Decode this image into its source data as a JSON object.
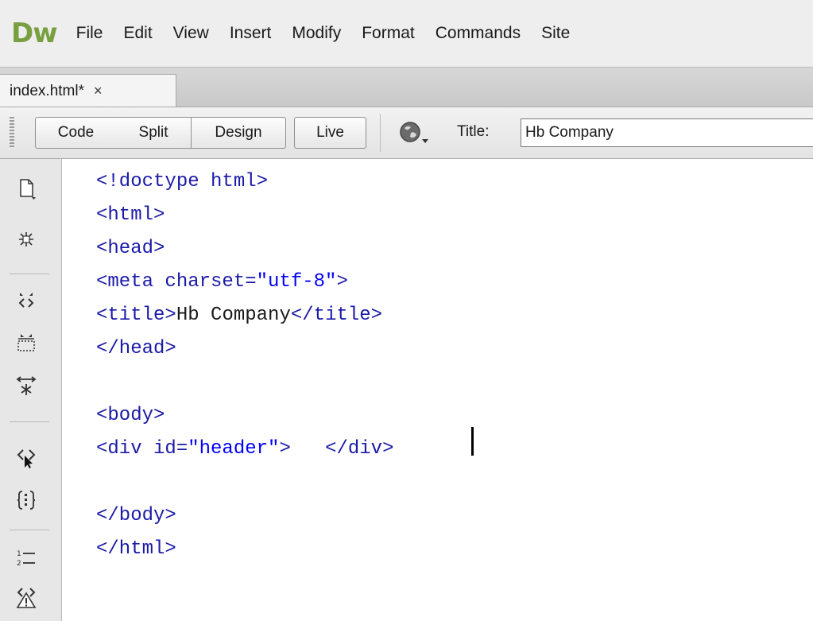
{
  "app": {
    "logo": "Dw",
    "menu": [
      "File",
      "Edit",
      "View",
      "Insert",
      "Modify",
      "Format",
      "Commands",
      "Site"
    ]
  },
  "document_tab": {
    "label": "index.html*",
    "close_glyph": "×"
  },
  "doc_toolbar": {
    "code_label": "Code",
    "split_label": "Split",
    "design_label": "Design",
    "live_label": "Live",
    "title_label": "Title:",
    "title_value": "Hb Company",
    "globe_icon": "globe-preview-icon"
  },
  "coding_toolbar": {
    "tools": [
      "open-documents-icon",
      "collapse-full-tag-icon",
      "collapse-selection-icon",
      "expand-all-icon",
      "select-parent-tag-icon",
      "balance-braces-icon",
      "line-numbers-icon",
      "highlight-invalid-code-icon"
    ]
  },
  "code": {
    "line1": "<!doctype html>",
    "line2": "<html>",
    "line3": "<head>",
    "line4_tag": "<meta charset=",
    "line4_val": "\"utf-8\"",
    "line4_end": ">",
    "line5_open": "<title>",
    "line5_text": "Hb Company",
    "line5_close": "</title>",
    "line6": "</head>",
    "line8": "<body>",
    "line9_tag": "<div id=",
    "line9_val": "\"header\"",
    "line9_end": ">",
    "line9_close": "</div>",
    "line11": "</body>",
    "line12": "</html>"
  },
  "colors": {
    "logo": "#78a040",
    "tag": "#1a1aa8",
    "attribute_value": "#0000ff",
    "text": "#1a1a1a"
  }
}
